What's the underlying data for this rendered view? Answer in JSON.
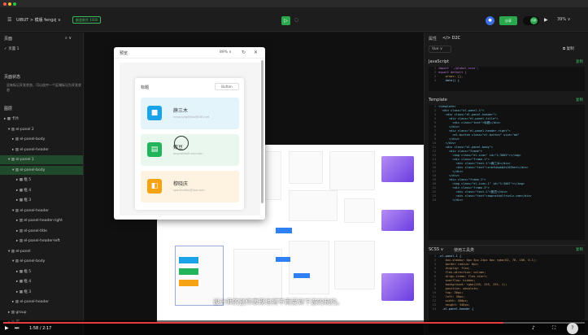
{
  "os": {
    "tab_label": "",
    "menu_items": [
      "",
      "",
      ""
    ],
    "right_text": ""
  },
  "toolbar": {
    "menu_icon": "hamburger-icon",
    "title": "UIBUT > 模版 fengzj ∨",
    "badge": "额度剩余 1000",
    "play_icon": "play-icon",
    "cursor_icon": "lasso-icon",
    "share_label": "分享",
    "toggle_label": "同步",
    "zoom": "39% ∨"
  },
  "left": {
    "section_pages": "页面",
    "page_item": "✓ 页面 1",
    "section_state": "页面状态",
    "state_desc": "没有标记开发状态，可以选中一个区域标记为开发状态",
    "section_layers": "图层",
    "layers": [
      {
        "label": "▸ ▦ 卡片",
        "indent": 1,
        "selected": false
      },
      {
        "label": "▾ ▥ el-panel 2",
        "indent": 2,
        "selected": false
      },
      {
        "label": "▸ ▥ el-panel-body",
        "indent": 3,
        "selected": false
      },
      {
        "label": "▸ ▥ el-panel-header",
        "indent": 3,
        "selected": false
      },
      {
        "label": "▾ ▥ el-panel 1",
        "indent": 2,
        "selected": true
      },
      {
        "label": "▾ ▥ el-panel-body",
        "indent": 3,
        "selected": true
      },
      {
        "label": "▸ ▦ 框 5",
        "indent": 4,
        "selected": false
      },
      {
        "label": "▸ ▦ 框 4",
        "indent": 4,
        "selected": false
      },
      {
        "label": "▸ ▦ 框 3",
        "indent": 4,
        "selected": false
      },
      {
        "label": "▾ ▥ el-panel-header",
        "indent": 3,
        "selected": false
      },
      {
        "label": "▸ ▥ el-panel-header-right",
        "indent": 4,
        "selected": false
      },
      {
        "label": "▸ ▥ el-panel-title",
        "indent": 4,
        "selected": false
      },
      {
        "label": "▸ ▥ el-panel-header-left",
        "indent": 4,
        "selected": false
      },
      {
        "label": "▾ ▥ el-panel",
        "indent": 2,
        "selected": false
      },
      {
        "label": "▾ ▥ el-panel-body",
        "indent": 3,
        "selected": false
      },
      {
        "label": "▸ ▦ 框 5",
        "indent": 4,
        "selected": false
      },
      {
        "label": "▸ ▦ 框 4",
        "indent": 4,
        "selected": false
      },
      {
        "label": "▸ ▦ 框 3",
        "indent": 4,
        "selected": false
      },
      {
        "label": "▸ ▥ el-panel-header",
        "indent": 3,
        "selected": false
      },
      {
        "label": "▸ ▥ group",
        "indent": 2,
        "selected": false
      },
      {
        "label": "▸ ▥ 组",
        "indent": 2,
        "selected": false
      }
    ]
  },
  "preview": {
    "title": "预览",
    "zoom": "89% ∨",
    "refresh_icon": "refresh-icon",
    "close_icon": "close-icon",
    "panel_title": "标题",
    "panel_button": "Button",
    "frames": [
      {
        "name": "薛三木",
        "email": "xmsnhyfg@kbu@163.net",
        "bg": "#e4f4fb",
        "icon_bg": "#1aa3e8",
        "icon": "■"
      },
      {
        "name": "甄豆",
        "email": "amprotdulfrunlz.com",
        "bg": "#e9f7ee",
        "icon_bg": "#22b45a",
        "icon": "▤"
      },
      {
        "name": "穆晓庆",
        "email": "sparkhzhen@live.com",
        "bg": "#fdf3e0",
        "icon_bg": "#f5a213",
        "icon": "◧"
      }
    ]
  },
  "right": {
    "tab_props": "属性",
    "tab_d2c": "</> D2C",
    "framework": "Vue ∨",
    "copy_all": "⧉ 复制",
    "js_title": "JavaScript",
    "copy": "复制",
    "js_lines": [
      "import './global.scss';",
      "export default {",
      "    props: {},",
      "    data() {"
    ],
    "tpl_title": "Template",
    "tpl_lines": [
      "<template>",
      "  <div class=\"el-panel-1\">",
      "    <div class=\"el-panel-header\">",
      "      <div class=\"el-panel-title\">",
      "        <div class=\"text\">标题</div>",
      "      </div>",
      "      <div class=\"el-panel-header-right\">",
      "        <el-button class=\"el-button\" size=\"md\"",
      "      </div>",
      "    </div>",
      "    <div class=\"el-panel-body\">",
      "      <div class=\"frame\">",
      "        <img class=\"el-icon\" id=\"1:3005\"></img>",
      "        <div class=\"frame-1\">",
      "          <div class=\"text-1\">薛三木</div>",
      "          <div class=\"text\">xrmfubpkb2s163net</div>",
      "        </div>",
      "      </div>",
      "      <div class=\"frame-1\">",
      "        <img class=\"el-icon-1\" id=\"1:3007\"></img>",
      "        <div class=\"frame-3\">",
      "          <div class=\"text-1\">甄豆</div>",
      "          <div class=\"text\">aaprotdulfrunlz.com</div>",
      "        </div>"
    ],
    "scss_title": "SCSS ∨",
    "scss_tool": "使用工具类",
    "scss_lines": [
      ".el-panel-1 {",
      "    box-shadow: 0px 5px 24px 0px rgba(62, 78, 106, 0.1);",
      "    border-radius: 8px;",
      "    display: flex;",
      "    flex-direction: column;",
      "    align-items: flex-start;",
      "    overflow: hidden;",
      "    background: rgba(255, 255, 255, 1);",
      "    position: absolute;",
      "    top: 30px;",
      "    left: 36px;",
      "    width: 500px;",
      "    height: 346px;",
      "  .el-panel-header {"
    ]
  },
  "video": {
    "subtitle": "设计师的创作表现也将不再受到下游的制约。",
    "time": "1:58 / 2:17",
    "progress": 0.86,
    "play_icon": "play-icon",
    "next_icon": "next-icon",
    "volume_icon": "volume-icon",
    "fullscreen_icon": "fullscreen-icon",
    "help_icon": "help-icon"
  }
}
